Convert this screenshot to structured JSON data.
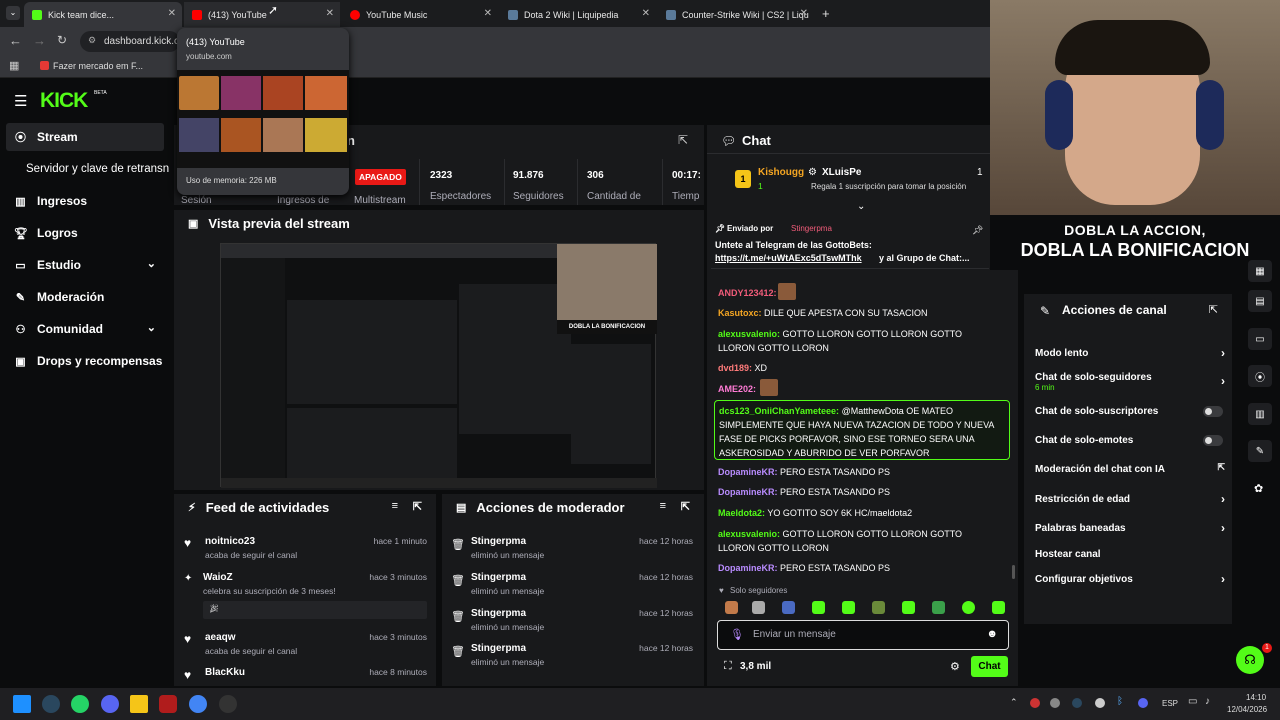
{
  "browser": {
    "tabs": [
      {
        "label": "Kick team dice...",
        "active": true
      },
      {
        "label": "(413) YouTube"
      },
      {
        "label": "YouTube Music"
      },
      {
        "label": "Dota 2 Wiki | Liquipedia"
      },
      {
        "label": "Counter-Strike Wiki | CS2 | Liqu"
      }
    ],
    "address": "dashboard.kick.co",
    "bookmark": "Fazer mercado em F...",
    "tooltip": {
      "title": "(413) YouTube",
      "domain": "youtube.com",
      "memory": "Uso de memoria: 226 MB"
    }
  },
  "brand": {
    "logo": "KICK",
    "beta": "BETA"
  },
  "sidebar": {
    "items": [
      {
        "label": "Stream",
        "icon": "stream-icon"
      },
      {
        "label": "Servidor y clave de retransn"
      },
      {
        "label": "Ingresos",
        "icon": "chart-icon"
      },
      {
        "label": "Logros",
        "icon": "trophy-icon"
      },
      {
        "label": "Estudio",
        "icon": "studio-icon"
      },
      {
        "label": "Moderación",
        "icon": "wrench-icon"
      },
      {
        "label": "Comunidad",
        "icon": "community-icon"
      },
      {
        "label": "Drops y recompensas",
        "icon": "drops-icon"
      }
    ]
  },
  "stats": {
    "partial_title": "n",
    "status_badge": "APAGADO",
    "session_label": "Sesión",
    "ingresos_label": "Ingresos de",
    "multistream_label": "Multistream",
    "items": [
      {
        "value": "2323",
        "label": "Espectadores"
      },
      {
        "value": "91.876",
        "label": "Seguidores"
      },
      {
        "value": "306",
        "label": "Cantidad de"
      },
      {
        "value": "00:17:",
        "label": "Tiemp"
      }
    ]
  },
  "preview": {
    "title": "Vista previa del stream"
  },
  "feed": {
    "title": "Feed de actividades",
    "items": [
      {
        "name": "noitnico23",
        "sub": "acaba de seguir el canal",
        "time": "hace 1 minuto"
      },
      {
        "name": "WaioZ",
        "sub": "celebra su suscripción de 3 meses!",
        "time": "hace 3 minutos"
      },
      {
        "name": "aeaqw",
        "sub": "acaba de seguir el canal",
        "time": "hace 3 minutos"
      },
      {
        "name": "BlacKku",
        "sub": "",
        "time": "hace 8 minutos"
      }
    ]
  },
  "mod": {
    "title": "Acciones de moderador",
    "items": [
      {
        "name": "Stingerpma",
        "sub": "eliminó un mensaje",
        "time": "hace 12 horas"
      },
      {
        "name": "Stingerpma",
        "sub": "eliminó un mensaje",
        "time": "hace 12 horas"
      },
      {
        "name": "Stingerpma",
        "sub": "eliminó un mensaje",
        "time": "hace 12 horas"
      },
      {
        "name": "Stingerpma",
        "sub": "eliminó un mensaje",
        "time": "hace 12 horas"
      }
    ]
  },
  "chat": {
    "title": "Chat",
    "top_gifter": {
      "rank": "1",
      "name": "Kishougg",
      "count": "1",
      "gifter": "XLuisPe",
      "note": "Regala 1 suscripción para tomar la posición",
      "right": "1"
    },
    "pinned": {
      "by": "Enviado por",
      "byname": "Stingerpma",
      "text1": "Untete al Telegram de las GottoBets:",
      "link": "https://t.me/+uWtAExc5dTswMThk",
      "text2": " y al Grupo de Chat:..."
    },
    "messages": [
      {
        "user": "ANDY123412:",
        "text": "",
        "color": "#f25c7a"
      },
      {
        "user": "Kasutoxc:",
        "text": " DILE QUE APESTA CON SU TASACION",
        "color": "#f5a623"
      },
      {
        "user": "alexusvalenio:",
        "text": " GOTTO LLORON    GOTTO LLORON    GOTTO",
        "color": "#53fc18"
      },
      {
        "user": "",
        "text": "LLORON    GOTTO LLORON",
        "color": "#fff"
      },
      {
        "user": "dvd189:",
        "text": " XD",
        "color": "#ff7b7b"
      },
      {
        "user": "AME202:",
        "text": "",
        "color": "#ff7bd5"
      },
      {
        "user": "dcs123_OniiChanYameteee:",
        "text": " @MatthewDota OE MATEO SIMPLEMENTE QUE HAYA NUEVA TAZACION DE TODO Y NUEVA FASE DE PICKS PORFAVOR, SINO ESE TORNEO SERA UNA ASKEROSIDAD Y ABURRIDO DE VER PORFAVOR",
        "color": "#53fc18"
      },
      {
        "user": "DopamineKR:",
        "text": " PERO ESTA TASANDO PS",
        "color": "#b98cff"
      },
      {
        "user": "DopamineKR:",
        "text": " PERO ESTA TASANDO PS",
        "color": "#b98cff"
      },
      {
        "user": "Maeldota2:",
        "text": " YO GOTITO SOY 6K HC/maeldota2",
        "color": "#53fc18"
      },
      {
        "user": "alexusvalenio:",
        "text": " GOTTO LLORON    GOTTO LLORON    GOTTO",
        "color": "#53fc18"
      },
      {
        "user": "",
        "text": "LLORON    GOTTO LLORON",
        "color": "#fff"
      },
      {
        "user": "DopamineKR:",
        "text": " PERO ESTA TASANDO PS",
        "color": "#b98cff"
      }
    ],
    "solo": "Solo seguidores",
    "input_placeholder": "Enviar un mensaje",
    "viewers": "3,8 mil",
    "send": "Chat"
  },
  "overlay": {
    "line1": "DOBLA LA ACCION,",
    "line2": "DOBLA LA BONIFICACION"
  },
  "canal": {
    "title": "Acciones de canal",
    "items": [
      {
        "label": "Modo lento",
        "kind": "chev"
      },
      {
        "label": "Chat de solo-seguidores",
        "sub": "6 min",
        "kind": "chev"
      },
      {
        "label": "Chat de solo-suscriptores",
        "kind": "toggle"
      },
      {
        "label": "Chat de solo-emotes",
        "kind": "toggle"
      },
      {
        "label": "Moderación del chat con IA",
        "kind": "ext"
      },
      {
        "label": "Restricción de edad",
        "kind": "chev"
      },
      {
        "label": "Palabras baneadas",
        "kind": "chev"
      },
      {
        "label": "Hostear canal",
        "kind": "none"
      },
      {
        "label": "Configurar objetivos",
        "kind": "chev"
      }
    ]
  },
  "taskbar": {
    "lang": "ESP",
    "time": "14:10",
    "date": "12/04/2026",
    "badge": "1"
  },
  "colors": {
    "accent": "#53fc18",
    "bg": "#0b0c0d",
    "panel": "#18191b",
    "red": "#e91916"
  }
}
